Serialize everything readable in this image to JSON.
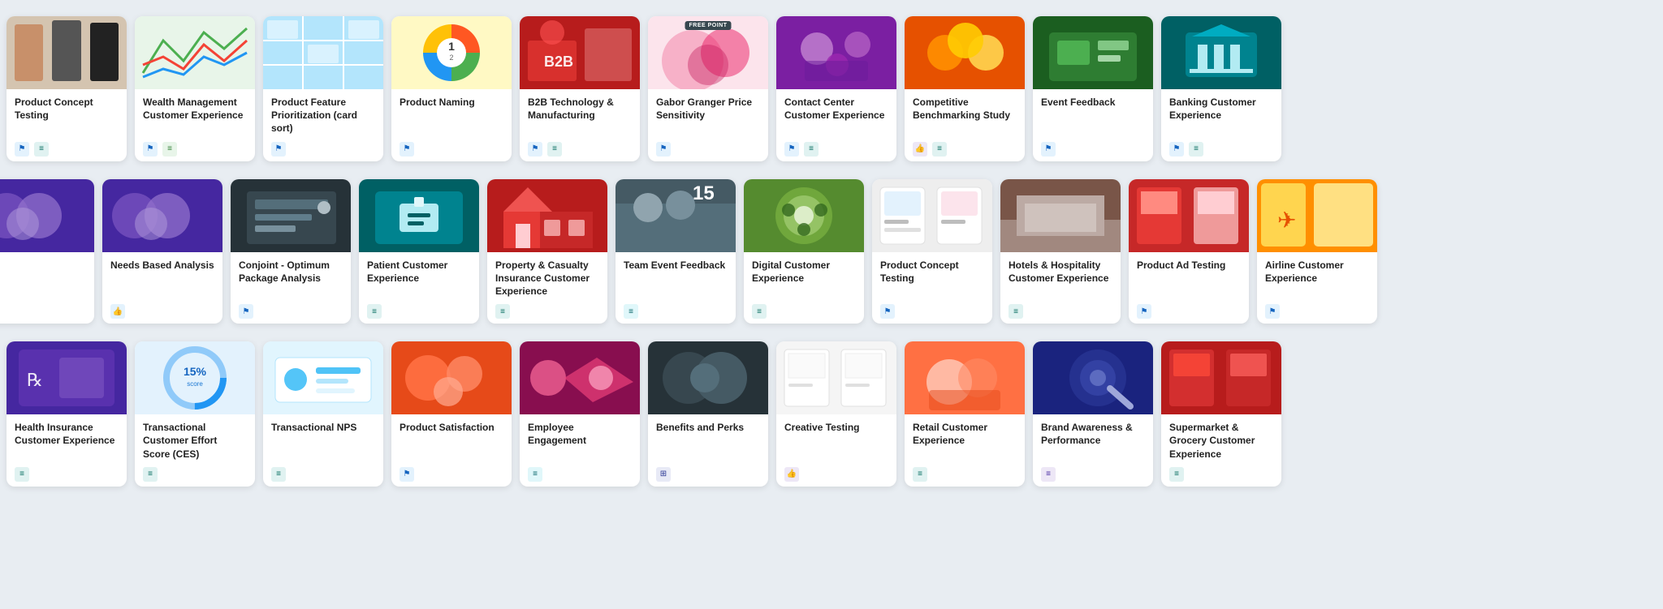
{
  "rows": [
    {
      "id": "row1",
      "cards": [
        {
          "id": "product-concept-testing-1",
          "title": "Product Concept Testing",
          "image_type": "clothesblack",
          "icons": [
            "blue-flag",
            "teal-chart"
          ],
          "partial": "none"
        },
        {
          "id": "wealth-management",
          "title": "Wealth Management Customer Experience",
          "image_type": "chart-green",
          "icons": [
            "blue-flag",
            "green-chart"
          ],
          "partial": "none"
        },
        {
          "id": "product-feature",
          "title": "Product Feature Prioritization (card sort)",
          "image_type": "grid-blue",
          "icons": [
            "blue-flag"
          ],
          "partial": "none"
        },
        {
          "id": "product-naming",
          "title": "Product Naming",
          "image_type": "pie-colorful",
          "icons": [
            "blue-flag"
          ],
          "partial": "none"
        },
        {
          "id": "b2b-tech",
          "title": "B2B Technology & Manufacturing",
          "image_type": "b2b-red",
          "icons": [
            "blue-flag",
            "teal-chart"
          ],
          "partial": "none"
        },
        {
          "id": "gabor-granger",
          "title": "Gabor Granger Price Sensitivity",
          "image_type": "gabor",
          "icons": [
            "blue-flag"
          ],
          "has_badge": true,
          "badge_text": "FREE POINT",
          "partial": "none"
        },
        {
          "id": "contact-center",
          "title": "Contact Center Customer Experience",
          "image_type": "contact",
          "icons": [
            "blue-flag",
            "teal-chart"
          ],
          "partial": "none"
        },
        {
          "id": "competitive-benchmarking",
          "title": "Competitive Benchmarking Study",
          "image_type": "competitive",
          "icons": [
            "purple-thumbs",
            "teal-chart"
          ],
          "partial": "none"
        },
        {
          "id": "event-feedback",
          "title": "Event Feedback",
          "image_type": "event",
          "icons": [
            "blue-flag"
          ],
          "partial": "none"
        },
        {
          "id": "banking-customer",
          "title": "Banking Customer Experience",
          "image_type": "banking",
          "icons": [
            "blue-flag",
            "teal-chart"
          ],
          "partial": "none"
        }
      ]
    },
    {
      "id": "row2",
      "cards": [
        {
          "id": "partial-left-row2",
          "title": "",
          "image_type": "needs",
          "icons": [],
          "partial": "left"
        },
        {
          "id": "needs-based",
          "title": "Needs Based Analysis",
          "image_type": "needs",
          "icons": [
            "blue-thumbs"
          ],
          "partial": "none"
        },
        {
          "id": "conjoint",
          "title": "Conjoint - Optimum Package Analysis",
          "image_type": "conjoint",
          "icons": [
            "blue-flag"
          ],
          "partial": "none"
        },
        {
          "id": "patient-customer",
          "title": "Patient Customer Experience",
          "image_type": "patient",
          "icons": [
            "teal-chart"
          ],
          "partial": "none"
        },
        {
          "id": "property-casualty",
          "title": "Property & Casualty Insurance Customer Experience",
          "image_type": "property",
          "icons": [
            "teal-chart"
          ],
          "partial": "none"
        },
        {
          "id": "team-event",
          "title": "Team Event Feedback",
          "image_type": "team",
          "icons": [
            "cyan-chart"
          ],
          "partial": "none"
        },
        {
          "id": "digital-customer",
          "title": "Digital Customer Experience",
          "image_type": "digital",
          "icons": [
            "teal-chart"
          ],
          "partial": "none"
        },
        {
          "id": "product-concept-testing-2",
          "title": "Product Concept Testing",
          "image_type": "product-concept",
          "icons": [
            "blue-flag"
          ],
          "partial": "none"
        },
        {
          "id": "hotels-hospitality",
          "title": "Hotels & Hospitality Customer Experience",
          "image_type": "hotels",
          "icons": [
            "teal-chart"
          ],
          "partial": "none"
        },
        {
          "id": "product-ad",
          "title": "Product Ad Testing",
          "image_type": "product-ad",
          "icons": [
            "blue-flag"
          ],
          "partial": "none"
        },
        {
          "id": "airline-customer",
          "title": "Airline Customer Experience",
          "image_type": "airline",
          "icons": [
            "blue-flag"
          ],
          "partial": "right"
        }
      ]
    },
    {
      "id": "row3",
      "cards": [
        {
          "id": "health-insurance",
          "title": "Health Insurance Customer Experience",
          "image_type": "health",
          "icons": [
            "teal-chart"
          ],
          "partial": "none"
        },
        {
          "id": "transactional-ces",
          "title": "Transactional Customer Effort Score (CES)",
          "image_type": "transactional",
          "icons": [
            "teal-chart"
          ],
          "partial": "none"
        },
        {
          "id": "transactional-nps",
          "title": "Transactional NPS",
          "image_type": "transactional-nps",
          "icons": [
            "teal-chart"
          ],
          "partial": "none"
        },
        {
          "id": "product-satisfaction",
          "title": "Product Satisfaction",
          "image_type": "product-satisfaction",
          "icons": [
            "blue-flag"
          ],
          "partial": "none"
        },
        {
          "id": "employee-engagement",
          "title": "Employee Engagement",
          "image_type": "employee",
          "icons": [
            "cyan-chart"
          ],
          "partial": "none"
        },
        {
          "id": "benefits-perks",
          "title": "Benefits and Perks",
          "image_type": "benefits",
          "icons": [
            "blue-grid"
          ],
          "partial": "none"
        },
        {
          "id": "creative-testing",
          "title": "Creative Testing",
          "image_type": "creative",
          "icons": [
            "purple-thumbs"
          ],
          "partial": "none"
        },
        {
          "id": "retail-customer",
          "title": "Retail Customer Experience",
          "image_type": "retail",
          "icons": [
            "teal-chart"
          ],
          "partial": "none"
        },
        {
          "id": "brand-awareness",
          "title": "Brand Awareness & Performance",
          "image_type": "brand",
          "icons": [
            "purple-chart"
          ],
          "partial": "none"
        },
        {
          "id": "supermarket",
          "title": "Supermarket & Grocery Customer Experience",
          "image_type": "supermarket",
          "icons": [
            "teal-chart"
          ],
          "partial": "none"
        }
      ]
    }
  ],
  "icon_map": {
    "blue-flag": {
      "symbol": "⚑",
      "color_class": "ic-blue"
    },
    "teal-chart": {
      "symbol": "≡",
      "color_class": "ic-teal"
    },
    "green-chart": {
      "symbol": "≡",
      "color_class": "ic-green"
    },
    "blue-thumbs": {
      "symbol": "👍",
      "color_class": "ic-blue"
    },
    "purple-thumbs": {
      "symbol": "👍",
      "color_class": "ic-purple"
    },
    "cyan-chart": {
      "symbol": "≡",
      "color_class": "ic-cyan"
    },
    "blue-grid": {
      "symbol": "⊞",
      "color_class": "ic-blue"
    },
    "purple-chart": {
      "symbol": "≡",
      "color_class": "ic-purple"
    }
  }
}
